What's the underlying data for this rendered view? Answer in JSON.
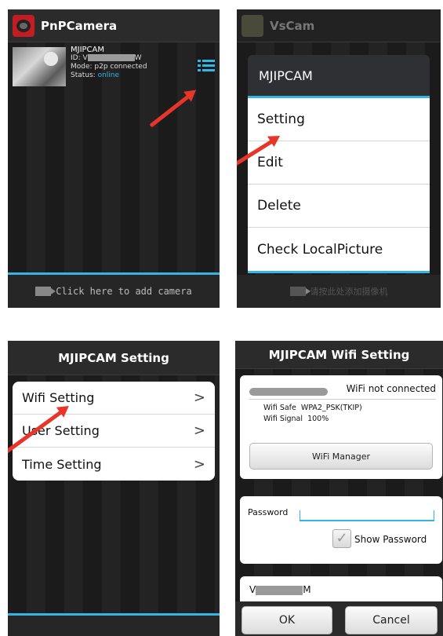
{
  "panel1": {
    "app_title": "PnPCamera",
    "camera": {
      "name": "MJIPCAM",
      "id_prefix": "ID: V",
      "id_suffix": "W",
      "mode": "Mode: p2p connected",
      "status_label": "Status:",
      "status_value": "online"
    },
    "add_camera_text": "Click here to add camera"
  },
  "panel2": {
    "app_title": "VsCam",
    "menu_title": "MJIPCAM",
    "menu_items": [
      "Setting",
      "Edit",
      "Delete",
      "Check LocalPicture"
    ],
    "bottom_text": "请按此处添加摄像机"
  },
  "panel3": {
    "title": "MJIPCAM  Setting",
    "items": [
      "Wifi Setting",
      "User Setting",
      "Time Setting"
    ],
    "chevron": ">"
  },
  "panel4": {
    "title": "MJIPCAM  Wifi Setting",
    "wifi_status": "WiFi not connected",
    "wifi_safe_label": "Wifi Safe",
    "wifi_safe_value": "WPA2_PSK(TKIP)",
    "wifi_signal_label": "Wifi Signal",
    "wifi_signal_value": "100%",
    "wifi_manager_label": "WiFi Manager",
    "password_label": "Password",
    "show_password_label": "Show Password",
    "ssid_prefix": "V",
    "ssid_suffix": "M",
    "ok_label": "OK",
    "cancel_label": "Cancel"
  },
  "colors": {
    "accent": "#33b5e5",
    "arrow": "#e8352a",
    "status_online": "#33b5e5"
  }
}
